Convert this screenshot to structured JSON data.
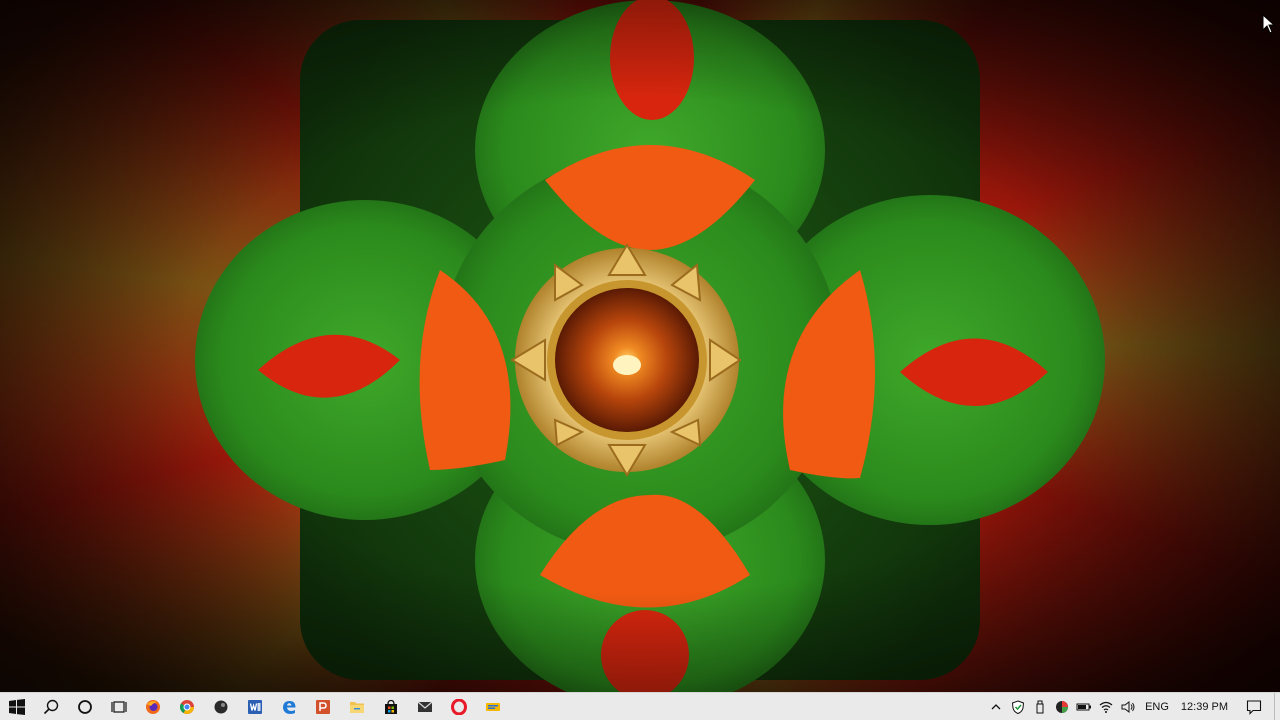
{
  "desktop": {
    "wallpaper": "diya-rangoli-icon"
  },
  "colors": {
    "rangoli_green": "#2f8f1e",
    "rangoli_orange": "#f05a12",
    "rangoli_red": "#d8260e",
    "flame": "#ffd66a",
    "taskbar_bg": "#eaeaea"
  },
  "taskbar": {
    "pinned": [
      {
        "name": "start-button",
        "icon": "windows-logo-icon"
      },
      {
        "name": "search-button",
        "icon": "search-icon"
      },
      {
        "name": "cortana-button",
        "icon": "cortana-circle-icon"
      },
      {
        "name": "task-view-button",
        "icon": "task-view-icon"
      },
      {
        "name": "firefox-button",
        "icon": "firefox-icon"
      },
      {
        "name": "chrome-button",
        "icon": "chrome-icon"
      },
      {
        "name": "app-dark-button",
        "icon": "dark-app-icon"
      },
      {
        "name": "word-button",
        "icon": "word-icon"
      },
      {
        "name": "edge-button",
        "icon": "edge-icon"
      },
      {
        "name": "powerpoint-button",
        "icon": "powerpoint-icon"
      },
      {
        "name": "file-explorer-button",
        "icon": "folder-icon"
      },
      {
        "name": "store-button",
        "icon": "store-bag-icon"
      },
      {
        "name": "mail-button",
        "icon": "mail-icon"
      },
      {
        "name": "opera-button",
        "icon": "opera-icon"
      },
      {
        "name": "sticky-app-button",
        "icon": "yellow-app-icon"
      }
    ],
    "tray": {
      "language": "ENG",
      "time": "12:39 PM"
    }
  }
}
